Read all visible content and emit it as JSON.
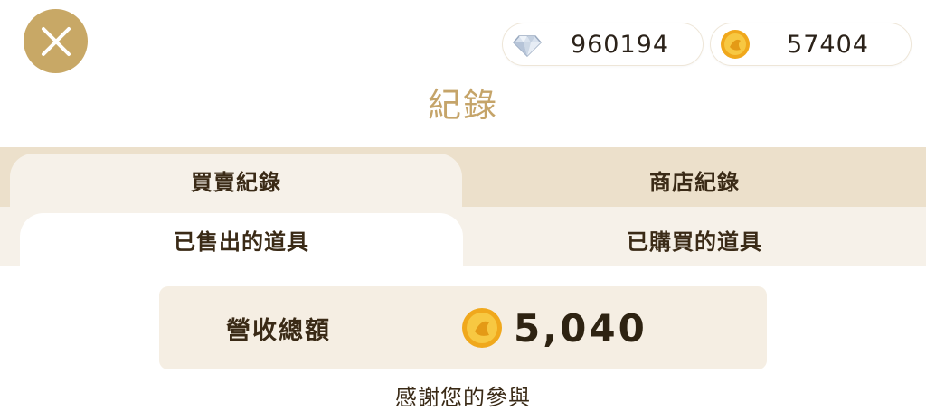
{
  "header": {
    "close_icon": "close-x-icon",
    "currencies": [
      {
        "icon": "diamond-icon",
        "value": "960194"
      },
      {
        "icon": "gold-coin-icon",
        "value": "57404"
      }
    ]
  },
  "title": "紀錄",
  "tabs": {
    "main": [
      {
        "label": "買賣紀錄",
        "active": true
      },
      {
        "label": "商店紀錄",
        "active": false
      }
    ],
    "sub": [
      {
        "label": "已售出的道具",
        "active": true
      },
      {
        "label": "已購買的道具",
        "active": false
      }
    ]
  },
  "summary": {
    "label": "營收總額",
    "icon": "gold-coin-icon",
    "value": "5,040"
  },
  "footer_text": "感謝您的參與",
  "colors": {
    "accent_gold": "#c8a866",
    "tab_bar": "#ece0cb",
    "panel": "#f5eee3"
  }
}
